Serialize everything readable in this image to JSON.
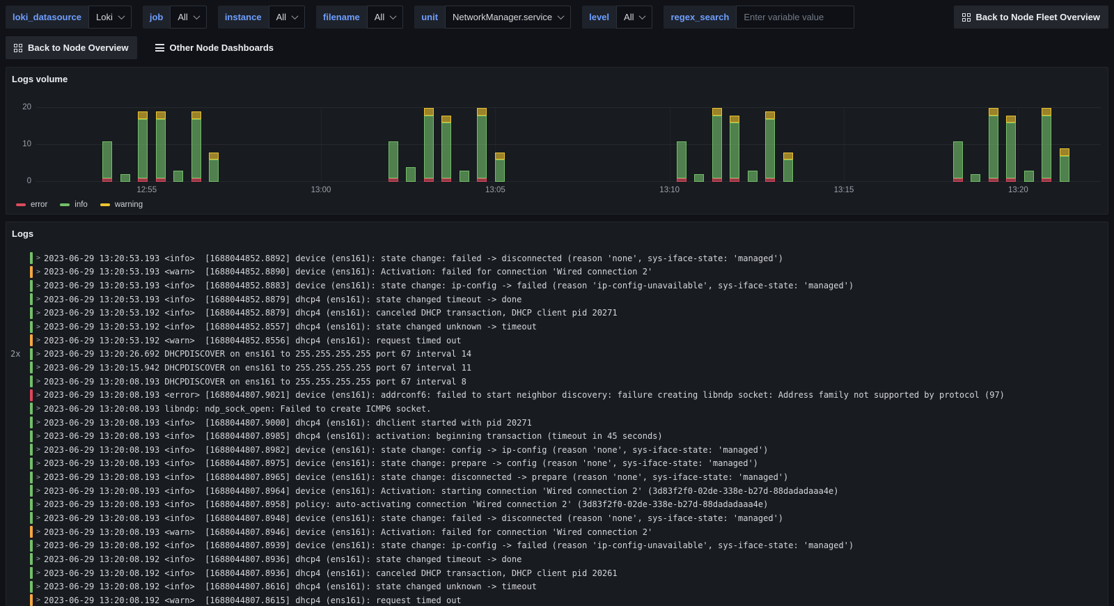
{
  "topbar": {
    "variables": [
      {
        "label": "loki_datasource",
        "type": "select",
        "value": "Loki"
      },
      {
        "label": "job",
        "type": "select",
        "value": "All"
      },
      {
        "label": "instance",
        "type": "select",
        "value": "All"
      },
      {
        "label": "filename",
        "type": "select",
        "value": "All"
      },
      {
        "label": "unit",
        "type": "select",
        "value": "NetworkManager.service"
      },
      {
        "label": "level",
        "type": "select",
        "value": "All"
      },
      {
        "label": "regex_search",
        "type": "input",
        "placeholder": "Enter variable value"
      }
    ],
    "fleet_button_label": "Back to Node Fleet Overview",
    "node_button_label": "Back to Node Overview",
    "dashboards_link_label": "Other Node Dashboards"
  },
  "logs_volume_panel": {
    "title": "Logs volume"
  },
  "chart_data": {
    "type": "bar",
    "stacked": true,
    "title": "Logs volume",
    "xlabel": "time",
    "ylabel": "",
    "ylim": [
      0,
      20
    ],
    "y_ticks": [
      0,
      10,
      20
    ],
    "x_domain_minutes_after_12_50": [
      1.81,
      32.37
    ],
    "x_ticks": [
      {
        "t": 5,
        "label": "12:55"
      },
      {
        "t": 10,
        "label": "13:00"
      },
      {
        "t": 15,
        "label": "13:05"
      },
      {
        "t": 20,
        "label": "13:10"
      },
      {
        "t": 25,
        "label": "13:15"
      },
      {
        "t": 30,
        "label": "13:20"
      }
    ],
    "series_order": [
      "error",
      "info",
      "warning"
    ],
    "colors": {
      "error": "#dc4b5d",
      "info": "#73bf69",
      "warning": "#ecc431"
    },
    "legend": [
      {
        "label": "error",
        "color": "#dc4b5d"
      },
      {
        "label": "info",
        "color": "#73bf69"
      },
      {
        "label": "warning",
        "color": "#ecc431"
      }
    ],
    "bars": [
      {
        "t": 3.87,
        "error": 1,
        "info": 10,
        "warning": 0
      },
      {
        "t": 4.38,
        "error": 0,
        "info": 2,
        "warning": 0
      },
      {
        "t": 4.89,
        "error": 1,
        "info": 16,
        "warning": 2
      },
      {
        "t": 5.4,
        "error": 1,
        "info": 16,
        "warning": 2
      },
      {
        "t": 5.91,
        "error": 0,
        "info": 3,
        "warning": 0
      },
      {
        "t": 6.42,
        "error": 1,
        "info": 16,
        "warning": 2
      },
      {
        "t": 6.93,
        "error": 0,
        "info": 6,
        "warning": 2
      },
      {
        "t": 12.07,
        "error": 1,
        "info": 10,
        "warning": 0
      },
      {
        "t": 12.58,
        "error": 0,
        "info": 4,
        "warning": 0
      },
      {
        "t": 13.09,
        "error": 1,
        "info": 17,
        "warning": 2
      },
      {
        "t": 13.6,
        "error": 1,
        "info": 15,
        "warning": 2
      },
      {
        "t": 14.11,
        "error": 0,
        "info": 3,
        "warning": 0
      },
      {
        "t": 14.62,
        "error": 1,
        "info": 17,
        "warning": 2
      },
      {
        "t": 15.13,
        "error": 0,
        "info": 6,
        "warning": 2
      },
      {
        "t": 20.34,
        "error": 1,
        "info": 10,
        "warning": 0
      },
      {
        "t": 20.85,
        "error": 0,
        "info": 2,
        "warning": 0
      },
      {
        "t": 21.36,
        "error": 1,
        "info": 17,
        "warning": 2
      },
      {
        "t": 21.87,
        "error": 1,
        "info": 15,
        "warning": 2
      },
      {
        "t": 22.38,
        "error": 0,
        "info": 3,
        "warning": 0
      },
      {
        "t": 22.89,
        "error": 1,
        "info": 16,
        "warning": 2
      },
      {
        "t": 23.4,
        "error": 0,
        "info": 6,
        "warning": 2
      },
      {
        "t": 28.27,
        "error": 1,
        "info": 10,
        "warning": 0
      },
      {
        "t": 28.78,
        "error": 0,
        "info": 2,
        "warning": 0
      },
      {
        "t": 29.29,
        "error": 1,
        "info": 17,
        "warning": 2
      },
      {
        "t": 29.8,
        "error": 1,
        "info": 15,
        "warning": 2
      },
      {
        "t": 30.31,
        "error": 0,
        "info": 3,
        "warning": 0
      },
      {
        "t": 30.82,
        "error": 1,
        "info": 17,
        "warning": 2
      },
      {
        "t": 31.33,
        "error": 0,
        "info": 7,
        "warning": 2
      }
    ]
  },
  "logs_panel": {
    "title": "Logs",
    "level_colors": {
      "info": "#73bf69",
      "warn": "#f5a742",
      "error": "#e0455c"
    },
    "rows": [
      {
        "count": "",
        "level": "info",
        "text": "2023-06-29 13:20:53.193 <info>  [1688044852.8892] device (ens161): state change: failed -> disconnected (reason 'none', sys-iface-state: 'managed')"
      },
      {
        "count": "",
        "level": "warn",
        "text": "2023-06-29 13:20:53.193 <warn>  [1688044852.8890] device (ens161): Activation: failed for connection 'Wired connection 2'"
      },
      {
        "count": "",
        "level": "info",
        "text": "2023-06-29 13:20:53.193 <info>  [1688044852.8883] device (ens161): state change: ip-config -> failed (reason 'ip-config-unavailable', sys-iface-state: 'managed')"
      },
      {
        "count": "",
        "level": "info",
        "text": "2023-06-29 13:20:53.193 <info>  [1688044852.8879] dhcp4 (ens161): state changed timeout -> done"
      },
      {
        "count": "",
        "level": "info",
        "text": "2023-06-29 13:20:53.192 <info>  [1688044852.8879] dhcp4 (ens161): canceled DHCP transaction, DHCP client pid 20271"
      },
      {
        "count": "",
        "level": "info",
        "text": "2023-06-29 13:20:53.192 <info>  [1688044852.8557] dhcp4 (ens161): state changed unknown -> timeout"
      },
      {
        "count": "",
        "level": "warn",
        "text": "2023-06-29 13:20:53.192 <warn>  [1688044852.8556] dhcp4 (ens161): request timed out"
      },
      {
        "count": "2x",
        "level": "info",
        "text": "2023-06-29 13:20:26.692 DHCPDISCOVER on ens161 to 255.255.255.255 port 67 interval 14"
      },
      {
        "count": "",
        "level": "info",
        "text": "2023-06-29 13:20:15.942 DHCPDISCOVER on ens161 to 255.255.255.255 port 67 interval 11"
      },
      {
        "count": "",
        "level": "info",
        "text": "2023-06-29 13:20:08.193 DHCPDISCOVER on ens161 to 255.255.255.255 port 67 interval 8"
      },
      {
        "count": "",
        "level": "error",
        "text": "2023-06-29 13:20:08.193 <error> [1688044807.9021] device (ens161): addrconf6: failed to start neighbor discovery: failure creating libndp socket: Address family not supported by protocol (97)"
      },
      {
        "count": "",
        "level": "info",
        "text": "2023-06-29 13:20:08.193 libndp: ndp_sock_open: Failed to create ICMP6 socket."
      },
      {
        "count": "",
        "level": "info",
        "text": "2023-06-29 13:20:08.193 <info>  [1688044807.9000] dhcp4 (ens161): dhclient started with pid 20271"
      },
      {
        "count": "",
        "level": "info",
        "text": "2023-06-29 13:20:08.193 <info>  [1688044807.8985] dhcp4 (ens161): activation: beginning transaction (timeout in 45 seconds)"
      },
      {
        "count": "",
        "level": "info",
        "text": "2023-06-29 13:20:08.193 <info>  [1688044807.8982] device (ens161): state change: config -> ip-config (reason 'none', sys-iface-state: 'managed')"
      },
      {
        "count": "",
        "level": "info",
        "text": "2023-06-29 13:20:08.193 <info>  [1688044807.8975] device (ens161): state change: prepare -> config (reason 'none', sys-iface-state: 'managed')"
      },
      {
        "count": "",
        "level": "info",
        "text": "2023-06-29 13:20:08.193 <info>  [1688044807.8965] device (ens161): state change: disconnected -> prepare (reason 'none', sys-iface-state: 'managed')"
      },
      {
        "count": "",
        "level": "info",
        "text": "2023-06-29 13:20:08.193 <info>  [1688044807.8964] device (ens161): Activation: starting connection 'Wired connection 2' (3d83f2f0-02de-338e-b27d-88dadadaaa4e)"
      },
      {
        "count": "",
        "level": "info",
        "text": "2023-06-29 13:20:08.193 <info>  [1688044807.8958] policy: auto-activating connection 'Wired connection 2' (3d83f2f0-02de-338e-b27d-88dadadaaa4e)"
      },
      {
        "count": "",
        "level": "info",
        "text": "2023-06-29 13:20:08.193 <info>  [1688044807.8948] device (ens161): state change: failed -> disconnected (reason 'none', sys-iface-state: 'managed')"
      },
      {
        "count": "",
        "level": "warn",
        "text": "2023-06-29 13:20:08.193 <warn>  [1688044807.8946] device (ens161): Activation: failed for connection 'Wired connection 2'"
      },
      {
        "count": "",
        "level": "info",
        "text": "2023-06-29 13:20:08.192 <info>  [1688044807.8939] device (ens161): state change: ip-config -> failed (reason 'ip-config-unavailable', sys-iface-state: 'managed')"
      },
      {
        "count": "",
        "level": "info",
        "text": "2023-06-29 13:20:08.192 <info>  [1688044807.8936] dhcp4 (ens161): state changed timeout -> done"
      },
      {
        "count": "",
        "level": "info",
        "text": "2023-06-29 13:20:08.192 <info>  [1688044807.8936] dhcp4 (ens161): canceled DHCP transaction, DHCP client pid 20261"
      },
      {
        "count": "",
        "level": "info",
        "text": "2023-06-29 13:20:08.192 <info>  [1688044807.8616] dhcp4 (ens161): state changed unknown -> timeout"
      },
      {
        "count": "",
        "level": "warn",
        "text": "2023-06-29 13:20:08.192 <warn>  [1688044807.8615] dhcp4 (ens161): request timed out"
      }
    ]
  }
}
